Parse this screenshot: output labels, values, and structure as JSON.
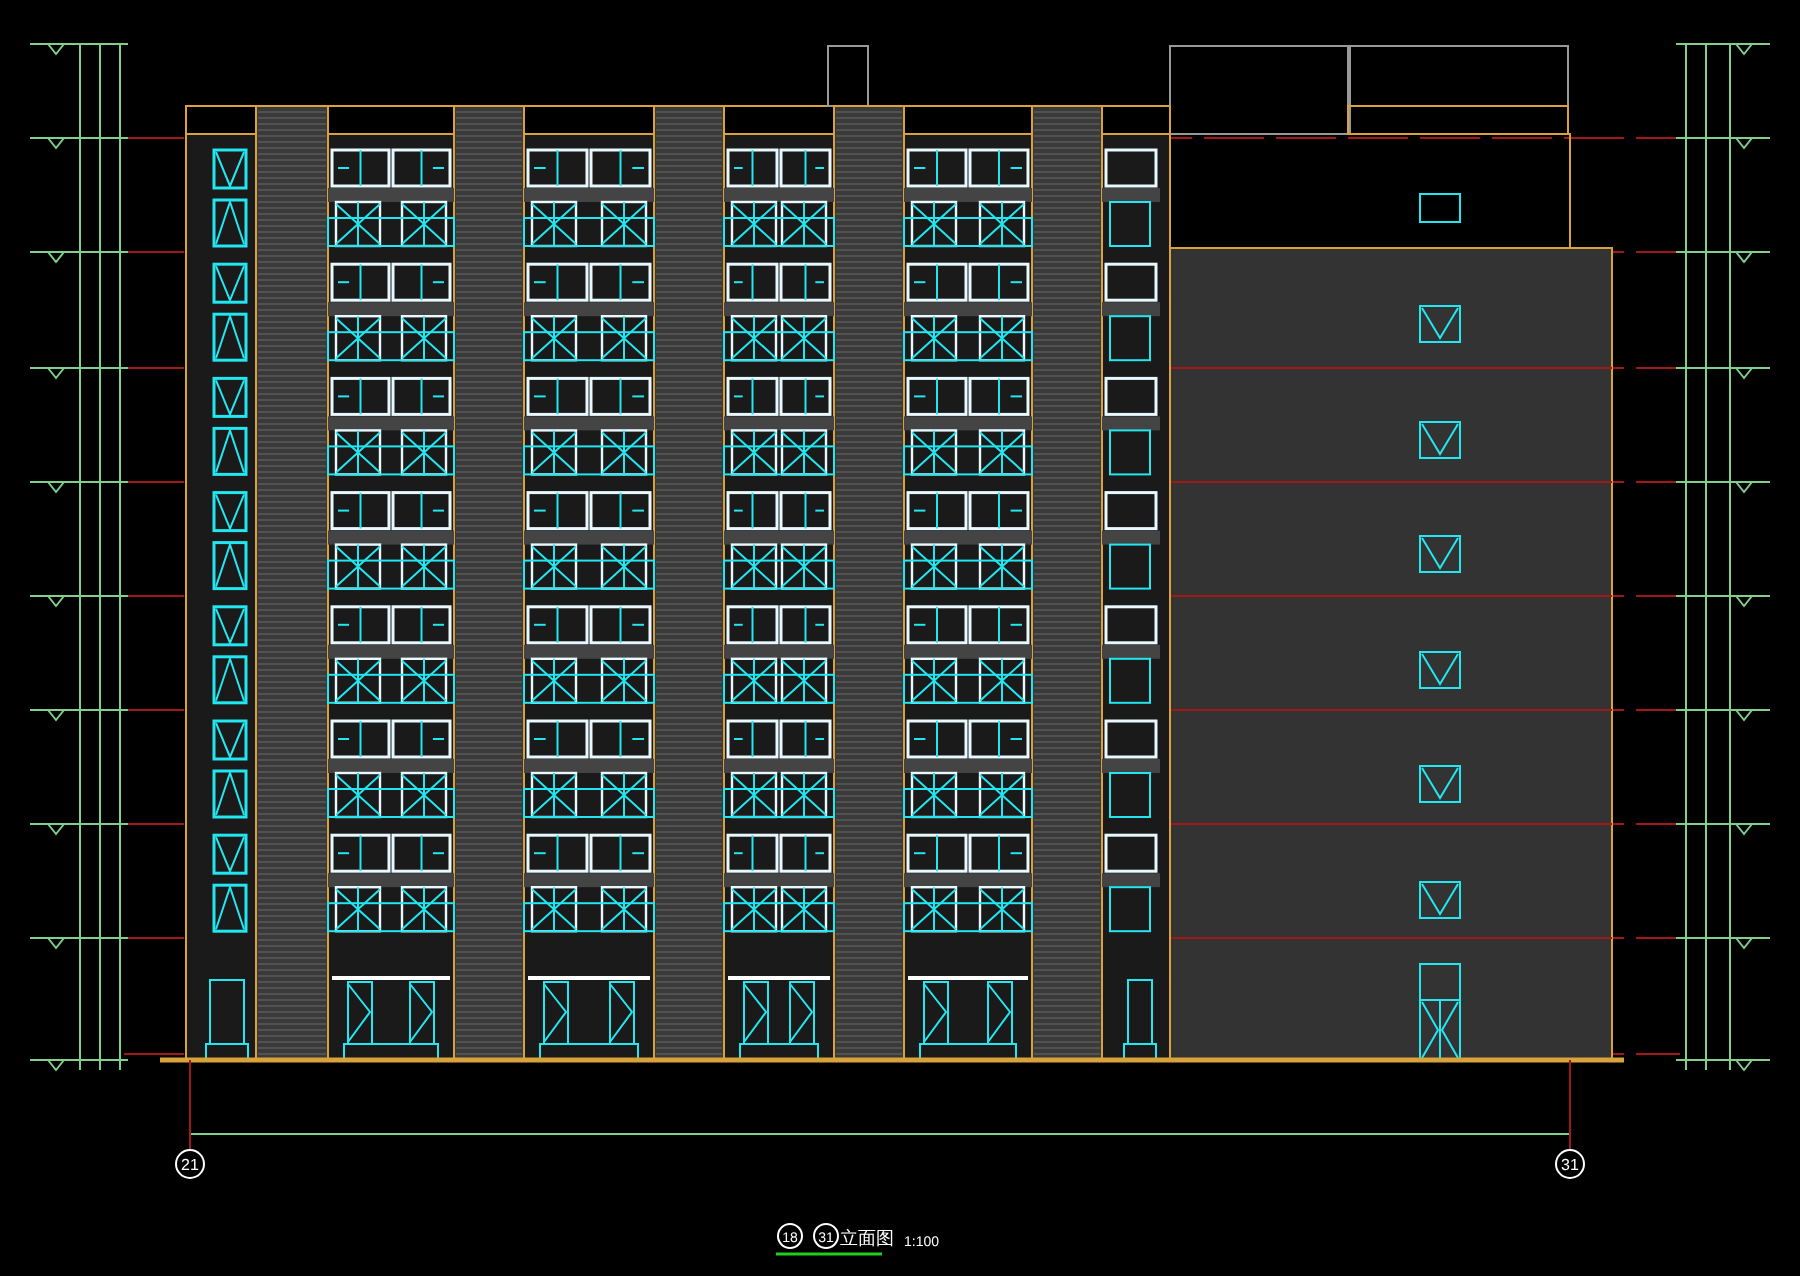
{
  "axes": [
    {
      "label": "21"
    },
    {
      "label": "31"
    }
  ],
  "title": {
    "axis_from": "18",
    "axis_to": "31",
    "text": "立面图",
    "scale": "1:100"
  }
}
